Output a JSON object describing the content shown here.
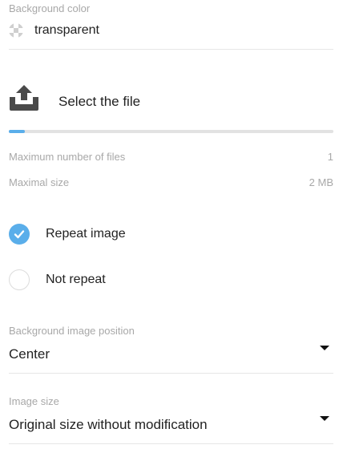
{
  "background_color": {
    "label": "Background color",
    "value": "transparent"
  },
  "upload": {
    "label": "Select the file",
    "progress_fraction": 0.05,
    "accent_color": "#5aaeea"
  },
  "limits": {
    "max_files_label": "Maximum number of files",
    "max_files_value": "1",
    "max_size_label": "Maximal size",
    "max_size_value": "2 MB"
  },
  "repeat_options": [
    {
      "label": "Repeat image",
      "checked": true
    },
    {
      "label": "Not repeat",
      "checked": false
    }
  ],
  "position_select": {
    "label": "Background image position",
    "value": "Center"
  },
  "size_select": {
    "label": "Image size",
    "value": "Original size without modification"
  }
}
